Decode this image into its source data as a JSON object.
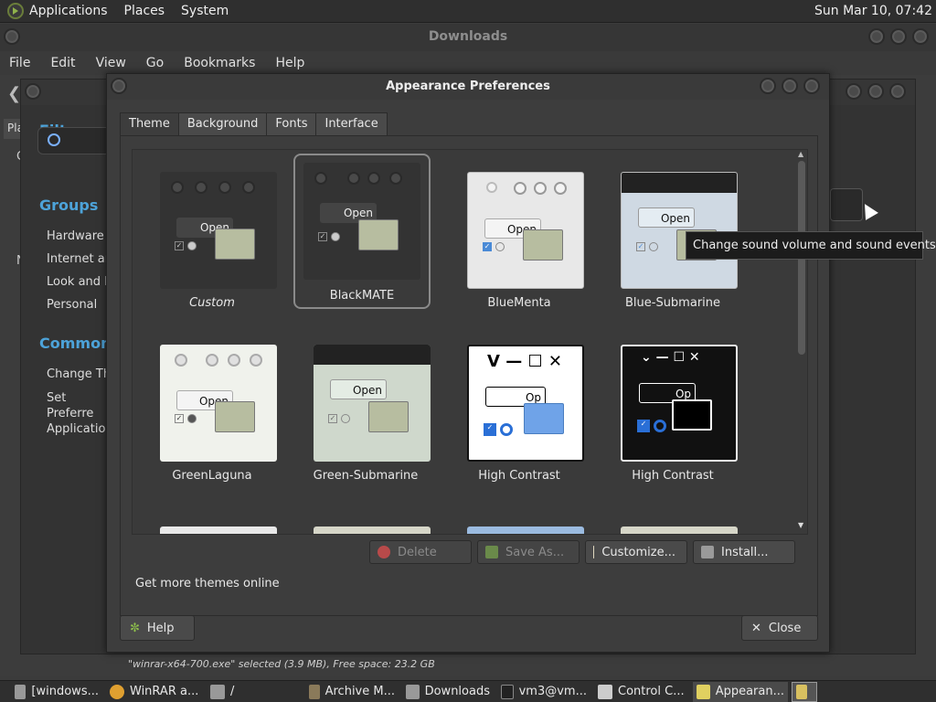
{
  "top_panel": {
    "menus": [
      "Applications",
      "Places",
      "System"
    ],
    "clock": "Sun Mar 10, 07:42"
  },
  "downloads_window": {
    "title": "Downloads",
    "menus": [
      "File",
      "Edit",
      "View",
      "Go",
      "Bookmarks",
      "Help"
    ],
    "places_tab": "Pla",
    "side_letter_c": "C",
    "side_letter_n": "N",
    "status": "\"winrar-x64-700.exe\" selected (3.9 MB), Free space: 23.2 GB"
  },
  "control_center": {
    "filter_heading": "Filter",
    "groups_heading": "Groups",
    "groups": [
      "Hardware",
      "Internet an",
      "Look and F",
      "Personal"
    ],
    "common_heading": "Common T",
    "common_items": [
      "Change Th",
      "Set Preferre\nApplication"
    ]
  },
  "dialog": {
    "title": "Appearance Preferences",
    "tabs": [
      "Theme",
      "Background",
      "Fonts",
      "Interface"
    ],
    "active_tab": "Theme",
    "themes": [
      {
        "name": "Custom",
        "button": "Open"
      },
      {
        "name": "BlackMATE",
        "button": "Open"
      },
      {
        "name": "BlueMenta",
        "button": "Open"
      },
      {
        "name": "Blue-Submarine",
        "button": "Open"
      },
      {
        "name": "GreenLaguna",
        "button": "Open"
      },
      {
        "name": "Green-Submarine",
        "button": "Open"
      },
      {
        "name": "High Contrast",
        "button": "Op"
      },
      {
        "name": "High Contrast",
        "button": "Op"
      }
    ],
    "selected_theme": "BlackMATE",
    "actions": {
      "delete": "Delete",
      "save_as": "Save As...",
      "customize": "Customize...",
      "install": "Install..."
    },
    "more_themes": "Get more themes online",
    "help": "Help",
    "close": "Close"
  },
  "tooltip": "Change sound volume and sound events",
  "taskbar": [
    {
      "label": "[windows...",
      "icon": "folder-icon"
    },
    {
      "label": "WinRAR a...",
      "icon": "chrome-icon"
    },
    {
      "label": "/",
      "icon": "folder-icon"
    },
    {
      "label": "Archive M...",
      "icon": "archive-icon"
    },
    {
      "label": "Downloads",
      "icon": "folder-icon"
    },
    {
      "label": "vm3@vm...",
      "icon": "terminal-icon"
    },
    {
      "label": "Control C...",
      "icon": "control-center-icon"
    },
    {
      "label": "Appearan...",
      "icon": "appearance-icon"
    }
  ],
  "colors": {
    "accent_blue": "#4da3d9",
    "panel_bg": "#2f2f2f",
    "window_bg": "#3d3d3d"
  }
}
